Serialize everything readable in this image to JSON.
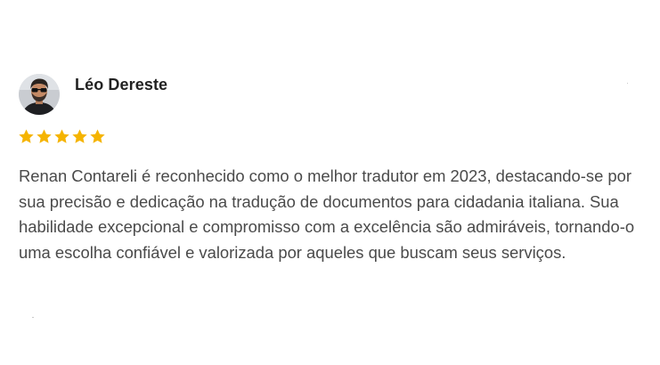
{
  "review": {
    "reviewer_name": "Léo Dereste",
    "avatar_icon": "user-photo-sunglasses",
    "rating": 5,
    "rating_max": 5,
    "star_color": "#f5b400",
    "text": "Renan Contareli é reconhecido como o melhor tradutor em 2023, destacando-se por sua precisão e dedicação na tradução de documentos para cidadania italiana. Sua habilidade excepcional e compromisso com a excelência são admiráveis, tornando-o uma escolha confiável e valorizada por aqueles que buscam seus serviços."
  }
}
